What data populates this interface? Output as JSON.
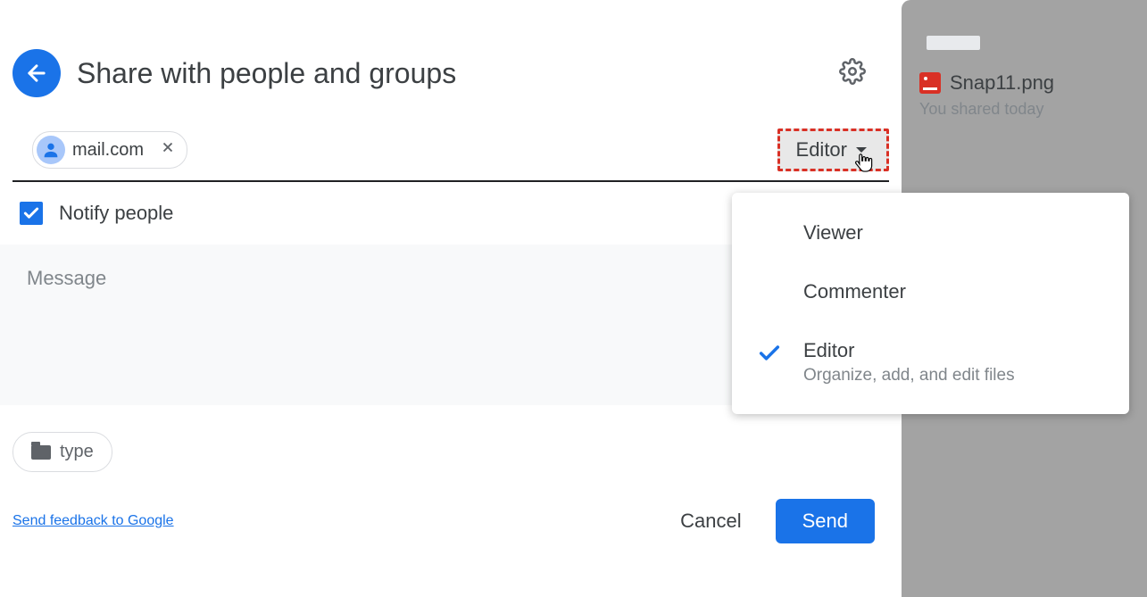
{
  "dialog": {
    "title": "Share with people and groups",
    "recipient_chip": {
      "email": "mail.com"
    },
    "role_selected_label": "Editor",
    "notify_label": "Notify people",
    "notify_checked": true,
    "message_placeholder": "Message",
    "attachment_label": "type",
    "feedback_link": "Send feedback to Google",
    "cancel_label": "Cancel",
    "send_label": "Send"
  },
  "dropdown": {
    "items": [
      {
        "label": "Viewer",
        "desc": ""
      },
      {
        "label": "Commenter",
        "desc": ""
      },
      {
        "label": "Editor",
        "desc": "Organize, add, and edit files"
      }
    ],
    "selected_index": 2
  },
  "sidebar": {
    "file_name": "Snap11.png",
    "file_status": "You shared today"
  }
}
